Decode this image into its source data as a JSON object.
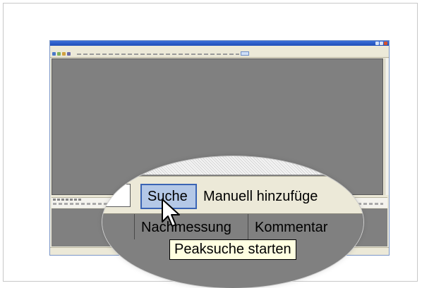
{
  "lens": {
    "search_button": "Suche",
    "manual_add": "Manuell hinzufüge",
    "columns": [
      "Nachmessung",
      "Kommentar"
    ]
  },
  "tooltip": "Peaksuche starten",
  "icons": {
    "cursor": "mouse-pointer-icon",
    "window_controls": [
      "minimize-icon",
      "maximize-icon",
      "close-icon"
    ]
  },
  "colors": {
    "workspace": "#808080",
    "button_highlight": "#b4c8e7",
    "button_border": "#3a64b4",
    "tooltip_bg": "#ffffe1",
    "titlebar": "#1f4fb8"
  }
}
